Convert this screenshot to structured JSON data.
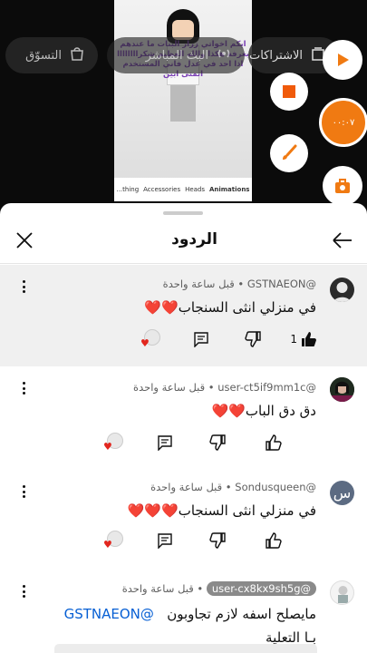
{
  "top": {
    "pill_shop": "التسوّق",
    "pill_live": "البث المباشر",
    "pill_subs": "الاشتراكات",
    "overlay_text": "ايكم اخواتي زرار البنات ما عندهم بغرفة هكذا والله العظيم شكراااااااا اذا احد في عدل فاني المستخدم اتمنى ابين",
    "tabs": [
      "...thing",
      "Accessories",
      "Heads",
      "Animations"
    ],
    "record_label": "٠٠:٠٧"
  },
  "sheet": {
    "title": "الردود"
  },
  "comments": [
    {
      "handle": "@GSTNAEON",
      "time": "قبل ساعة واحدة",
      "text": "في منزلي انثى السنجاب",
      "hearts": "❤️❤️",
      "likes": "1"
    },
    {
      "handle": "@user-ct5if9mm1c",
      "time": "قبل ساعة واحدة",
      "text": "دق دق الباب",
      "hearts": "❤️❤️",
      "likes": ""
    },
    {
      "handle": "@Sondusqueen",
      "time": "قبل ساعة واحدة",
      "text": "في منزلي انثى السنجاب",
      "hearts": "❤️❤️❤️",
      "likes": "",
      "avatar_letter": "س"
    },
    {
      "handle": "@user-cx8kx9sh5g",
      "time": "قبل ساعة واحدة",
      "text": "مايصلح اسفه لازم تجاوبون",
      "mention": "@GSTNAEON",
      "text2": "بـا التعلية"
    }
  ],
  "colors": {
    "accent": "#f07a12",
    "heart": "#e2261e",
    "link": "#065fd4"
  }
}
